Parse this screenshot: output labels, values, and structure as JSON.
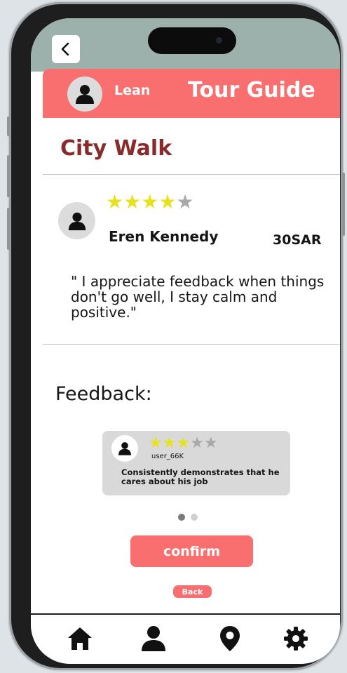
{
  "header": {
    "username": "Lean",
    "app_title": "Tour Guide",
    "avatar_icon": "user-avatar-icon"
  },
  "tour": {
    "title": "City Walk"
  },
  "guide": {
    "name": "Eren Kennedy",
    "price": "30SAR",
    "rating": 4,
    "rating_max": 5,
    "quote": "\" I appreciate feedback when things don't go well, I stay calm and positive.\""
  },
  "feedback": {
    "heading": "Feedback:",
    "reviews": [
      {
        "username": "user_66K",
        "rating": 3,
        "rating_max": 5,
        "text": "Consistently demonstrates that he cares about his job"
      }
    ],
    "carousel": {
      "count": 2,
      "active": 0
    }
  },
  "actions": {
    "confirm_label": "confirm",
    "back_label": "Back"
  },
  "colors": {
    "accent": "#f96e6e",
    "title": "#8a2b2b",
    "star_on": "#e7e21d",
    "star_off": "#a9a9a9",
    "statusbar": "#9db1ac"
  },
  "tabbar": {
    "items": [
      "home-icon",
      "profile-icon",
      "location-pin-icon",
      "settings-gear-icon"
    ]
  }
}
